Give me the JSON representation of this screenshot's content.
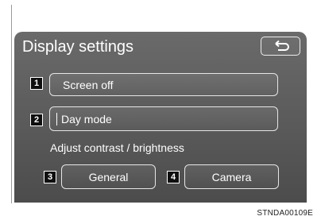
{
  "screen": {
    "title": "Display settings",
    "back_icon": "return-arrow-icon"
  },
  "buttons": {
    "screen_off": {
      "callout": "1",
      "label": "Screen off"
    },
    "day_mode": {
      "callout": "2",
      "label": "Day mode"
    },
    "general": {
      "callout": "3",
      "label": "General"
    },
    "camera": {
      "callout": "4",
      "label": "Camera"
    }
  },
  "section": {
    "adjust_label": "Adjust contrast / brightness"
  },
  "figure": {
    "code": "STNDA00109E"
  },
  "colors": {
    "screen_background": "#5d5d5d",
    "button_border": "#e6e6e6",
    "callout_background": "#0f0f0f",
    "text": "#ffffff"
  }
}
